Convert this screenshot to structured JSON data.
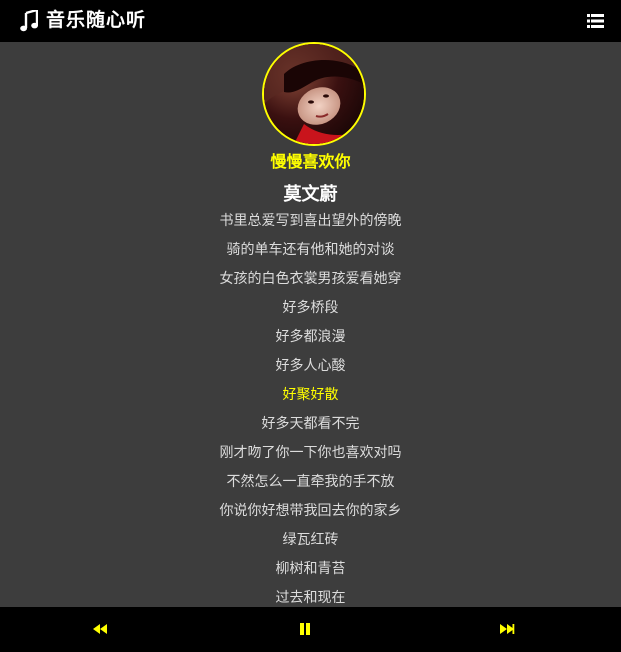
{
  "header": {
    "title": "音乐随心听",
    "logo_icon": "music-note-icon",
    "menu_icon": "list-menu-icon"
  },
  "player": {
    "song_title": "慢慢喜欢你",
    "artist": "莫文蔚",
    "accent_color": "#ffff00",
    "lyrics": [
      "书里总爱写到喜出望外的傍晚",
      "骑的单车还有他和她的对谈",
      "女孩的白色衣裳男孩爱看她穿",
      "好多桥段",
      "好多都浪漫",
      "好多人心酸",
      "好聚好散",
      "好多天都看不完",
      "刚才吻了你一下你也喜欢对吗",
      "不然怎么一直牵我的手不放",
      "你说你好想带我回去你的家乡",
      "绿瓦红砖",
      "柳树和青苔",
      "过去和现在"
    ],
    "active_lyric_index": 6
  },
  "controls": {
    "prev_icon": "backward-icon",
    "pause_icon": "pause-icon",
    "next_icon": "forward-icon"
  }
}
